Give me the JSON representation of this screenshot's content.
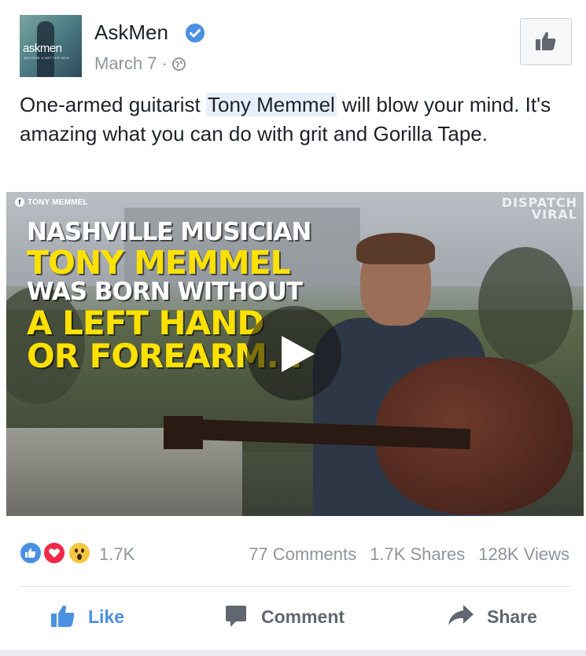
{
  "post": {
    "page_name": "AskMen",
    "date": "March 7",
    "separator": "·",
    "avatar_logo": "askmen",
    "avatar_tagline": "BECOME A BETTER MAN",
    "text_before": "One-armed guitarist ",
    "mention": "Tony Memmel",
    "text_after": " will blow your mind. It's amazing what you can do with grit and Gorilla Tape."
  },
  "video": {
    "channel": "TONY MEMMEL",
    "watermark_line1": "DISPATCH",
    "watermark_line2": "VIRAL",
    "headline": [
      "NASHVILLE MUSICIAN",
      "TONY MEMMEL",
      "WAS BORN WITHOUT",
      "A LEFT HAND",
      "OR FOREARM..."
    ]
  },
  "stats": {
    "reactions": "1.7K",
    "comments": "77 Comments",
    "shares": "1.7K Shares",
    "views": "128K Views"
  },
  "actions": {
    "like": "Like",
    "comment": "Comment",
    "share": "Share"
  },
  "colors": {
    "accent": "#4a90e2",
    "text": "#1d2129",
    "secondary_text": "#90949c",
    "mention_bg": "#e7effb",
    "headline_yellow": "#ffe100"
  },
  "icons": [
    "verified-badge-icon",
    "globe-icon",
    "thumbs-up-icon",
    "play-icon",
    "like-reaction-icon",
    "love-reaction-icon",
    "wow-reaction-icon",
    "comment-icon",
    "share-icon"
  ]
}
